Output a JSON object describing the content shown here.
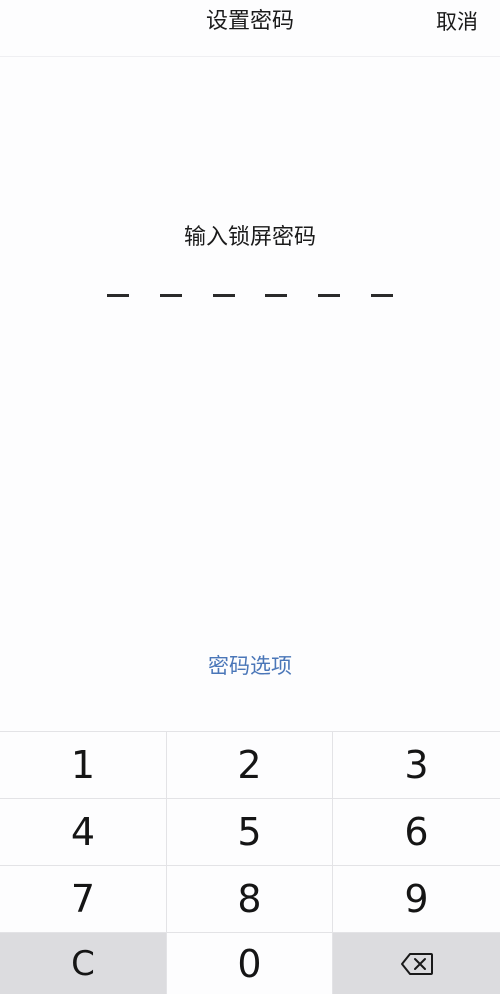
{
  "header": {
    "title": "设置密码",
    "cancel_label": "取消"
  },
  "main": {
    "prompt": "输入锁屏密码",
    "pin_length": 6,
    "entered_digits": 0,
    "options_link": "密码选项"
  },
  "keypad": {
    "keys": [
      "1",
      "2",
      "3",
      "4",
      "5",
      "6",
      "7",
      "8",
      "9",
      "C",
      "0"
    ],
    "clear_label": "C",
    "backspace_icon": "backspace-icon"
  },
  "colors": {
    "link": "#4a76b8",
    "key_gray": "#dcdcdf",
    "text": "#1b1b1b"
  }
}
